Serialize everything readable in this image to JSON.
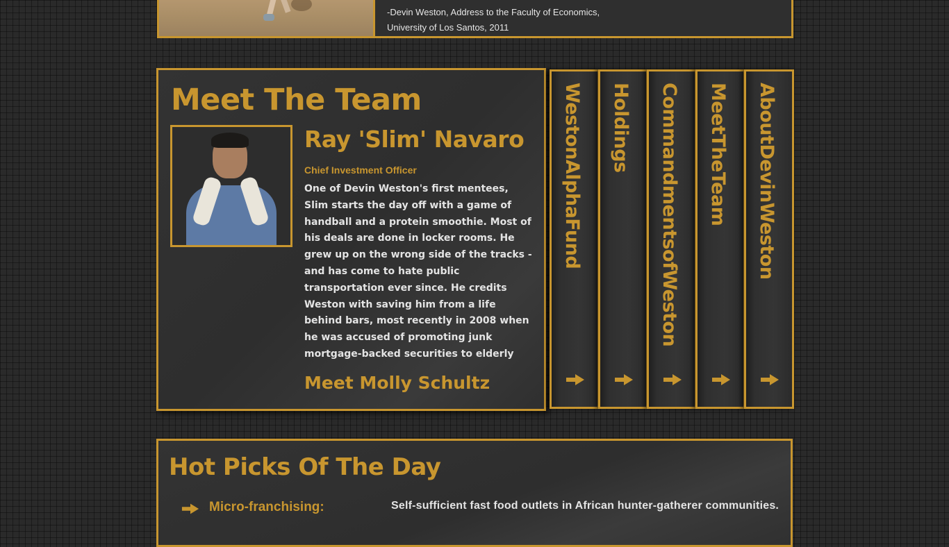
{
  "quote": {
    "attribution_line1": "-Devin Weston, Address to the Faculty of Economics,",
    "attribution_line2": "University of Los Santos, 2011"
  },
  "team": {
    "title": "Meet The Team",
    "member": {
      "name": "Ray 'Slim' Navaro",
      "role": "Chief Investment Officer",
      "bio": "One of Devin Weston's first mentees, Slim starts the day off with a game of handball and a protein smoothie. Most of his deals are done in locker rooms. He grew up on the wrong side of the tracks - and has come to hate public transportation ever since. He credits Weston with saving him from a life behind bars, most recently in 2008 when he was accused of promoting junk mortgage-backed securities to elderly investors then shorting those same securities for massive"
    },
    "next_link": "Meet Molly Schultz"
  },
  "tabs": [
    {
      "label": "WestonAlphaFund",
      "icon": "arrow-right-icon"
    },
    {
      "label": "Holdings",
      "icon": "arrow-right-icon"
    },
    {
      "label": "CommandmentsofWeston",
      "icon": "arrow-right-icon"
    },
    {
      "label": "MeetTheTeam",
      "icon": "arrow-right-icon"
    },
    {
      "label": "AboutDevinWeston",
      "icon": "arrow-right-icon"
    }
  ],
  "picks": {
    "title": "Hot Picks Of The Day",
    "items": [
      {
        "label": "Micro-franchising:",
        "description": "Self-sufficient fast food outlets in African hunter-gatherer communities."
      }
    ]
  },
  "colors": {
    "accent": "#c8962f",
    "background": "#2a2a2a",
    "panel": "#2f2f2f",
    "text": "#e4e4e4"
  }
}
